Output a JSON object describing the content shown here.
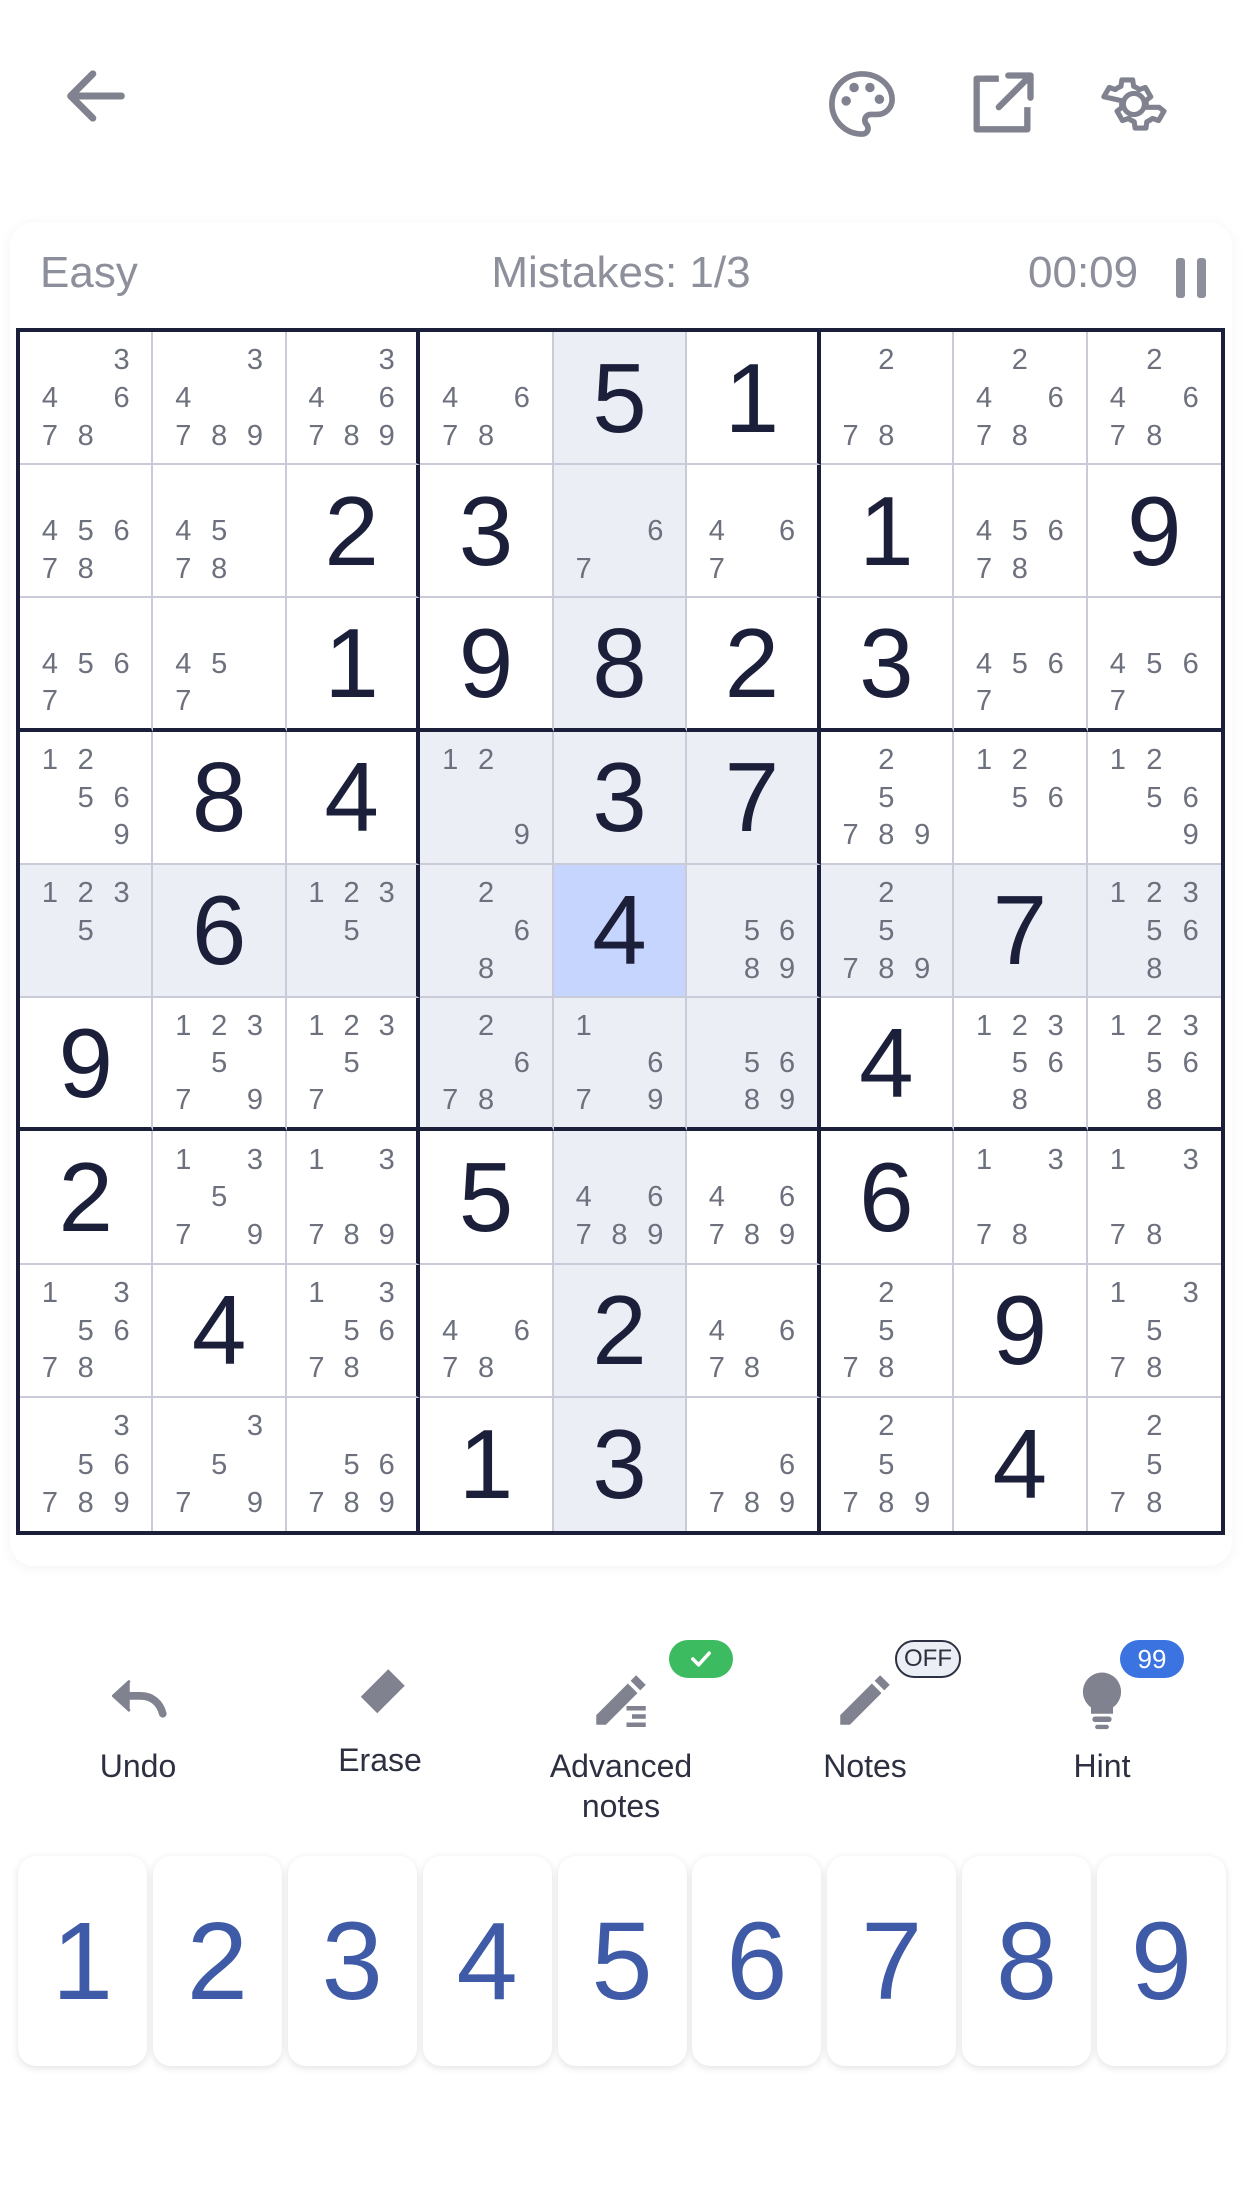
{
  "topbar": {
    "back_icon": "arrow-left-icon",
    "icons": [
      "palette-icon",
      "share-external-icon",
      "gear-icon"
    ]
  },
  "status": {
    "difficulty": "Easy",
    "mistakes": "Mistakes: 1/3",
    "timer": "00:09"
  },
  "board": [
    [
      "n:3,4,6,7,8",
      "n:3,4,7,8,9",
      "n:3,4,6,7,8,9",
      "n:4,6,7,8",
      "5",
      "1",
      "n:2,7,8",
      "n:2,4,6,7,8",
      "n:2,4,6,7,8"
    ],
    [
      "n:4,5,6,7,8",
      "n:4,5,7,8",
      "2",
      "3",
      "n:6,7",
      "n:4,6,7",
      "1",
      "n:4,5,6,7,8",
      "9"
    ],
    [
      "n:4,5,6,7",
      "n:4,5,7",
      "1",
      "9",
      "8",
      "2",
      "3",
      "n:4,5,6,7",
      "n:4,5,6,7"
    ],
    [
      "n:1,2,5,6,9",
      "8",
      "4",
      "n:1,2,9",
      "3",
      "7",
      "n:2,5,7,8,9",
      "n:1,2,5,6",
      "n:1,2,5,6,9"
    ],
    [
      "n:1,2,3,5",
      "6",
      "n:1,2,3,5",
      "n:2,6,8",
      "4",
      "n:5,6,8,9",
      "n:2,5,7,8,9",
      "7",
      "n:1,2,3,5,6,8"
    ],
    [
      "9",
      "n:1,2,3,5,7,9",
      "n:1,2,3,5,7",
      "n:2,6,7,8",
      "n:1,6,7,9",
      "n:5,6,8,9",
      "4",
      "n:1,2,3,5,6,8",
      "n:1,2,3,5,6,8"
    ],
    [
      "2",
      "n:1,3,5,7,9",
      "n:1,3,7,8,9",
      "5",
      "n:4,6,7,8,9",
      "n:4,6,7,8,9",
      "6",
      "n:1,3,7,8",
      "n:1,3,7,8"
    ],
    [
      "n:1,3,5,6,7,8",
      "4",
      "n:1,3,5,6,7,8",
      "n:4,6,7,8",
      "2",
      "n:4,6,7,8",
      "n:2,5,7,8",
      "9",
      "n:1,3,5,7,8"
    ],
    [
      "n:3,5,6,7,8,9",
      "n:3,5,7,9",
      "n:5,6,7,8,9",
      "1",
      "3",
      "n:6,7,8,9",
      "n:2,5,7,8,9",
      "4",
      "n:2,5,7,8"
    ]
  ],
  "selected_cell": [
    4,
    4
  ],
  "tools": {
    "undo": {
      "label": "Undo",
      "icon": "undo-icon"
    },
    "erase": {
      "label": "Erase",
      "icon": "eraser-icon"
    },
    "advanced_notes": {
      "label": "Advanced\nnotes",
      "icon": "advanced-notes-pencil-icon",
      "badge": "check-icon"
    },
    "notes": {
      "label": "Notes",
      "icon": "pencil-icon",
      "badge": "OFF"
    },
    "hint": {
      "label": "Hint",
      "icon": "lightbulb-icon",
      "badge": "99"
    }
  },
  "numpad": [
    "1",
    "2",
    "3",
    "4",
    "5",
    "6",
    "7",
    "8",
    "9"
  ],
  "colors": {
    "accent": "#3f5aa6",
    "selected_cell": "#c6d5fd",
    "highlight": "#eceef5",
    "grid_dark": "#1c1f3a",
    "badge_green": "#3dbb61",
    "badge_blue": "#3b73e0"
  }
}
